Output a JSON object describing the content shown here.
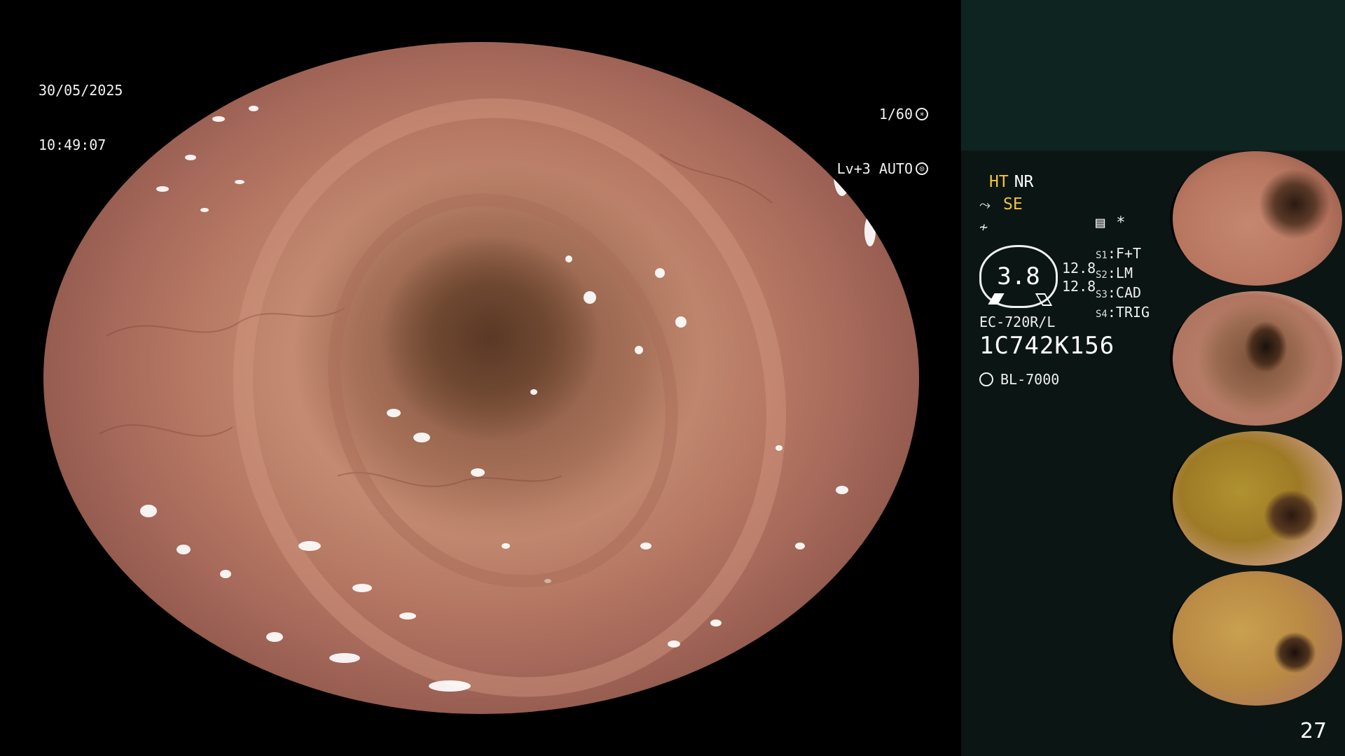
{
  "overlay": {
    "date": "30/05/2025",
    "time": "10:49:07",
    "shutter_speed": "1/60",
    "level_mode": "Lv+3 AUTO"
  },
  "panel": {
    "mode_ht": "HT",
    "mode_nr": "NR",
    "mode_se": "SE",
    "asterisk": "*",
    "gauge_value": "3.8",
    "gauge_val_1": "12.8",
    "gauge_val_2": "12.8",
    "settings": [
      {
        "key": "S1",
        "value": "F+T"
      },
      {
        "key": "S2",
        "value": "LM"
      },
      {
        "key": "S3",
        "value": "CAD"
      },
      {
        "key": "S4",
        "value": "TRIG"
      }
    ],
    "scope_model": "EC-720R/L",
    "scope_serial": "1C742K156",
    "light_source": "BL-7000"
  },
  "thumbnails": [
    {
      "id": "thumb-1"
    },
    {
      "id": "thumb-2"
    },
    {
      "id": "thumb-3"
    },
    {
      "id": "thumb-4"
    }
  ],
  "page_number": "27",
  "colors": {
    "accent_yellow": "#f3c33a",
    "panel_bg": "#0b1614",
    "panel_top_bg": "#0e2420"
  }
}
